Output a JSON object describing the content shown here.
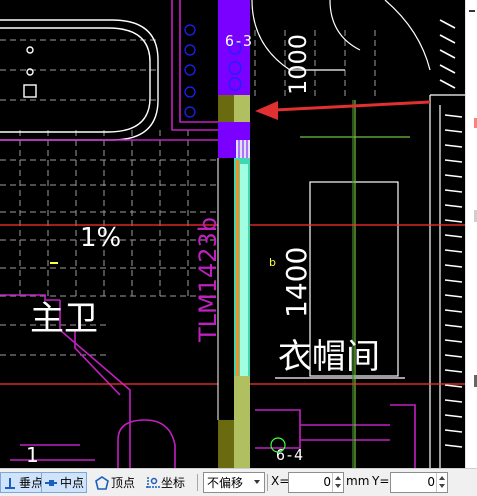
{
  "drawing": {
    "section_label_top": "6-3",
    "section_label_bottom": "6-4",
    "dim_vertical_top": "1000",
    "dim_vertical_main": "1400",
    "window_tag": "TLM1423b",
    "slope_label": "1%",
    "room_bath": "主卫",
    "room_closet": "衣帽间",
    "text_point_marker": "b",
    "colors": {
      "background": "#000000",
      "wall_purple": "#7a00ff",
      "magenta": "#c020c0",
      "grid_line": "#ff3030",
      "window_teal": "#40d8b0",
      "olive": "#8a8a20",
      "white": "#ffffff",
      "arrow_red": "#e03030",
      "axis_green": "#70c040"
    }
  },
  "toolbar": {
    "perpendicular_label": "垂点",
    "midpoint_label": "中点",
    "vertex_label": "顶点",
    "coordinate_label": "坐标",
    "offset_mode_value": "不偏移",
    "x_label": "X=",
    "x_value": "0",
    "x_unit": "mm",
    "y_label": "Y=",
    "y_value": "0",
    "icons": {
      "perpendicular": "perpendicular-snap-icon",
      "midpoint": "midpoint-snap-icon",
      "vertex": "vertex-snap-icon",
      "coordinate": "coordinate-snap-icon"
    }
  }
}
